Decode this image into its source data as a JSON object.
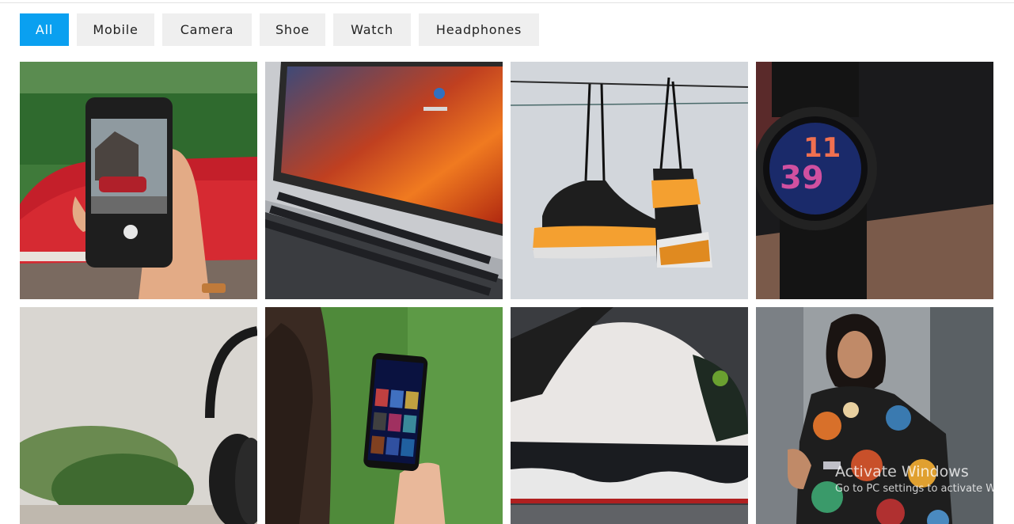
{
  "filters": [
    {
      "label": "All",
      "active": true
    },
    {
      "label": "Mobile",
      "active": false
    },
    {
      "label": "Camera",
      "active": false
    },
    {
      "label": "Shoe",
      "active": false
    },
    {
      "label": "Watch",
      "active": false
    },
    {
      "label": "Headphones",
      "active": false
    }
  ],
  "gallery": [
    {
      "subject": "hand holding phone photographing red car",
      "category": "Camera"
    },
    {
      "subject": "laptop with orange wallpaper",
      "category": "Mobile"
    },
    {
      "subject": "sneakers hanging on wire",
      "category": "Shoe"
    },
    {
      "subject": "smartwatch showing 11:39",
      "category": "Watch"
    },
    {
      "subject": "black headphones with plant",
      "category": "Headphones"
    },
    {
      "subject": "hand holding phone with streaming app",
      "category": "Mobile"
    },
    {
      "subject": "white and black basketball sneaker",
      "category": "Shoe"
    },
    {
      "subject": "man in floral jacket wearing watch",
      "category": "Watch"
    }
  ],
  "watermark": {
    "title": "Activate Windows",
    "subtitle": "Go to PC settings to activate Windows."
  },
  "colors": {
    "accent": "#0aa0f0",
    "button_bg": "#efefef"
  }
}
